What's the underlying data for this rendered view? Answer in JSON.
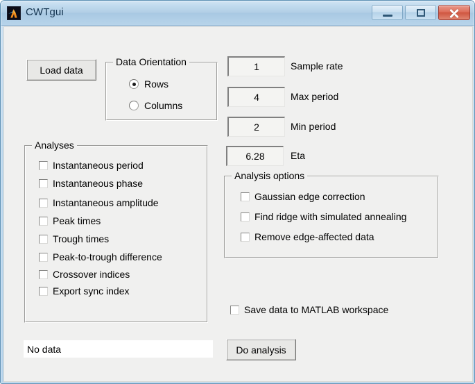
{
  "window": {
    "title": "CWTgui",
    "icon": "matlab-logo-icon",
    "controls": {
      "minimize": "minimize-icon",
      "maximize": "maximize-icon",
      "close": "close-icon"
    }
  },
  "toolbar": {
    "load_data_label": "Load data"
  },
  "data_orientation": {
    "title": "Data Orientation",
    "options": [
      {
        "label": "Rows",
        "selected": true
      },
      {
        "label": "Columns",
        "selected": false
      }
    ]
  },
  "parameters": [
    {
      "label": "Sample rate",
      "value": "1"
    },
    {
      "label": "Max period",
      "value": "4"
    },
    {
      "label": "Min period",
      "value": "2"
    },
    {
      "label": "Eta",
      "value": "6.28"
    }
  ],
  "analyses": {
    "title": "Analyses",
    "items": [
      {
        "label": "Instantaneous period",
        "checked": false
      },
      {
        "label": "Instantaneous phase",
        "checked": false
      },
      {
        "label": "Instantaneous amplitude",
        "checked": false
      },
      {
        "label": "Peak times",
        "checked": false
      },
      {
        "label": "Trough times",
        "checked": false
      },
      {
        "label": "Peak-to-trough difference",
        "checked": false
      },
      {
        "label": "Crossover indices",
        "checked": false
      },
      {
        "label": "Export sync index",
        "checked": false
      }
    ]
  },
  "analysis_options": {
    "title": "Analysis options",
    "items": [
      {
        "label": "Gaussian edge correction",
        "checked": false
      },
      {
        "label": "Find ridge with simulated annealing",
        "checked": false
      },
      {
        "label": "Remove edge-affected data",
        "checked": false
      }
    ]
  },
  "save_option": {
    "label": "Save data to MATLAB workspace",
    "checked": false
  },
  "status": {
    "text": "No data"
  },
  "actions": {
    "do_analysis_label": "Do analysis"
  },
  "colors": {
    "client_background": "#f0f0ef",
    "titlebar_blue": "#b4d2ea",
    "close_red": "#cf5640",
    "field_white": "#ffffff"
  }
}
